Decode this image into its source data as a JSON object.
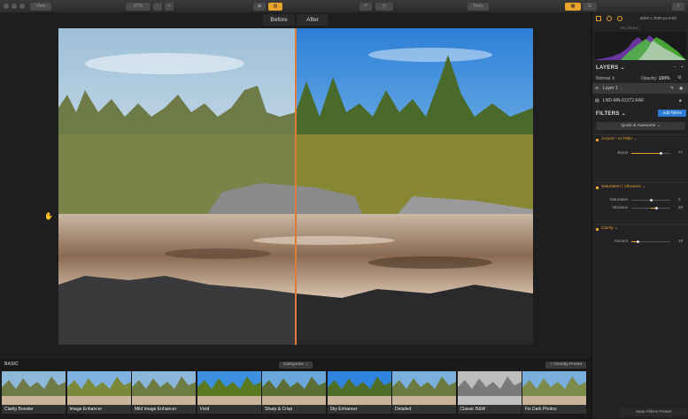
{
  "toolbar": {
    "view_label": "View",
    "zoom_label": "27%",
    "zoom_minus": "−",
    "zoom_plus": "+",
    "tools_label": "Tools"
  },
  "compare": {
    "before_label": "Before",
    "after_label": "After"
  },
  "panel": {
    "image_dims": "6000 x 4000 px",
    "bit_depth": "8-bit",
    "exif": "ISO 200   f/16",
    "layers_title": "LAYERS",
    "blend_mode": "Normal",
    "opacity_label": "Opacity:",
    "opacity_value": "100%",
    "layers": [
      {
        "name": "Layer 1"
      },
      {
        "name": "LND-MN-01372.RAF"
      }
    ],
    "filters_title": "FILTERS",
    "add_filters_label": "Add Filters",
    "quick_label": "Quick & Awesome",
    "accent": {
      "title": "Accent - AI Filter",
      "boost_label": "Boost",
      "boost_value": "77"
    },
    "saturation": {
      "title": "Saturation | Vibrance",
      "saturation_label": "Saturation",
      "saturation_value": "0",
      "vibrance_label": "Vibrance",
      "vibrance_value": "29"
    },
    "clarity": {
      "title": "Clarity",
      "amount_label": "Amount",
      "amount_value": "18"
    },
    "save_preset_label": "Save Filters Preset"
  },
  "slider_fractions": {
    "boost": 0.77,
    "saturation": 0.5,
    "vibrance": 0.64,
    "amount": 0.18
  },
  "presets": {
    "section_label": "BASIC",
    "categories_label": "Categories",
    "overlay_label": "+ Overlay Preset",
    "items": [
      {
        "name": "Clarity Booster"
      },
      {
        "name": "Image Enhancer"
      },
      {
        "name": "Mild Image Enhancer"
      },
      {
        "name": "Vivid"
      },
      {
        "name": "Sharp & Crisp"
      },
      {
        "name": "Sky Enhancer"
      },
      {
        "name": "Detailed"
      },
      {
        "name": "Classic B&W"
      },
      {
        "name": "Fix Dark Photos"
      }
    ]
  },
  "colors": {
    "accent": "#e8a32c",
    "split_line": "#e07a38",
    "button_blue": "#2c7bd4"
  }
}
